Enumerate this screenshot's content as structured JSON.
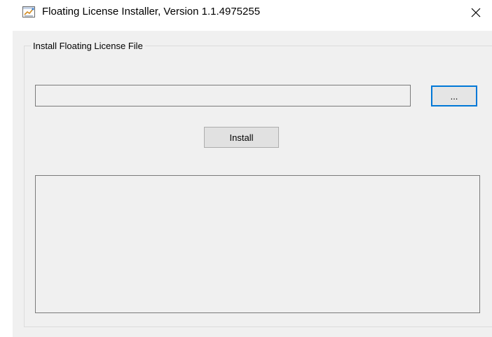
{
  "window": {
    "title": "Floating License Installer, Version 1.1.4975255",
    "icon": "license-app-icon",
    "close_icon": "close-icon"
  },
  "group": {
    "label": "Install Floating License File"
  },
  "file_path": {
    "value": "",
    "placeholder": ""
  },
  "browse_button": {
    "label": "..."
  },
  "install_button": {
    "label": "Install"
  },
  "log_output": {
    "value": ""
  },
  "colors": {
    "client_background": "#f0f0f0",
    "focus_border": "#0078d7",
    "button_face": "#e1e1e1"
  }
}
